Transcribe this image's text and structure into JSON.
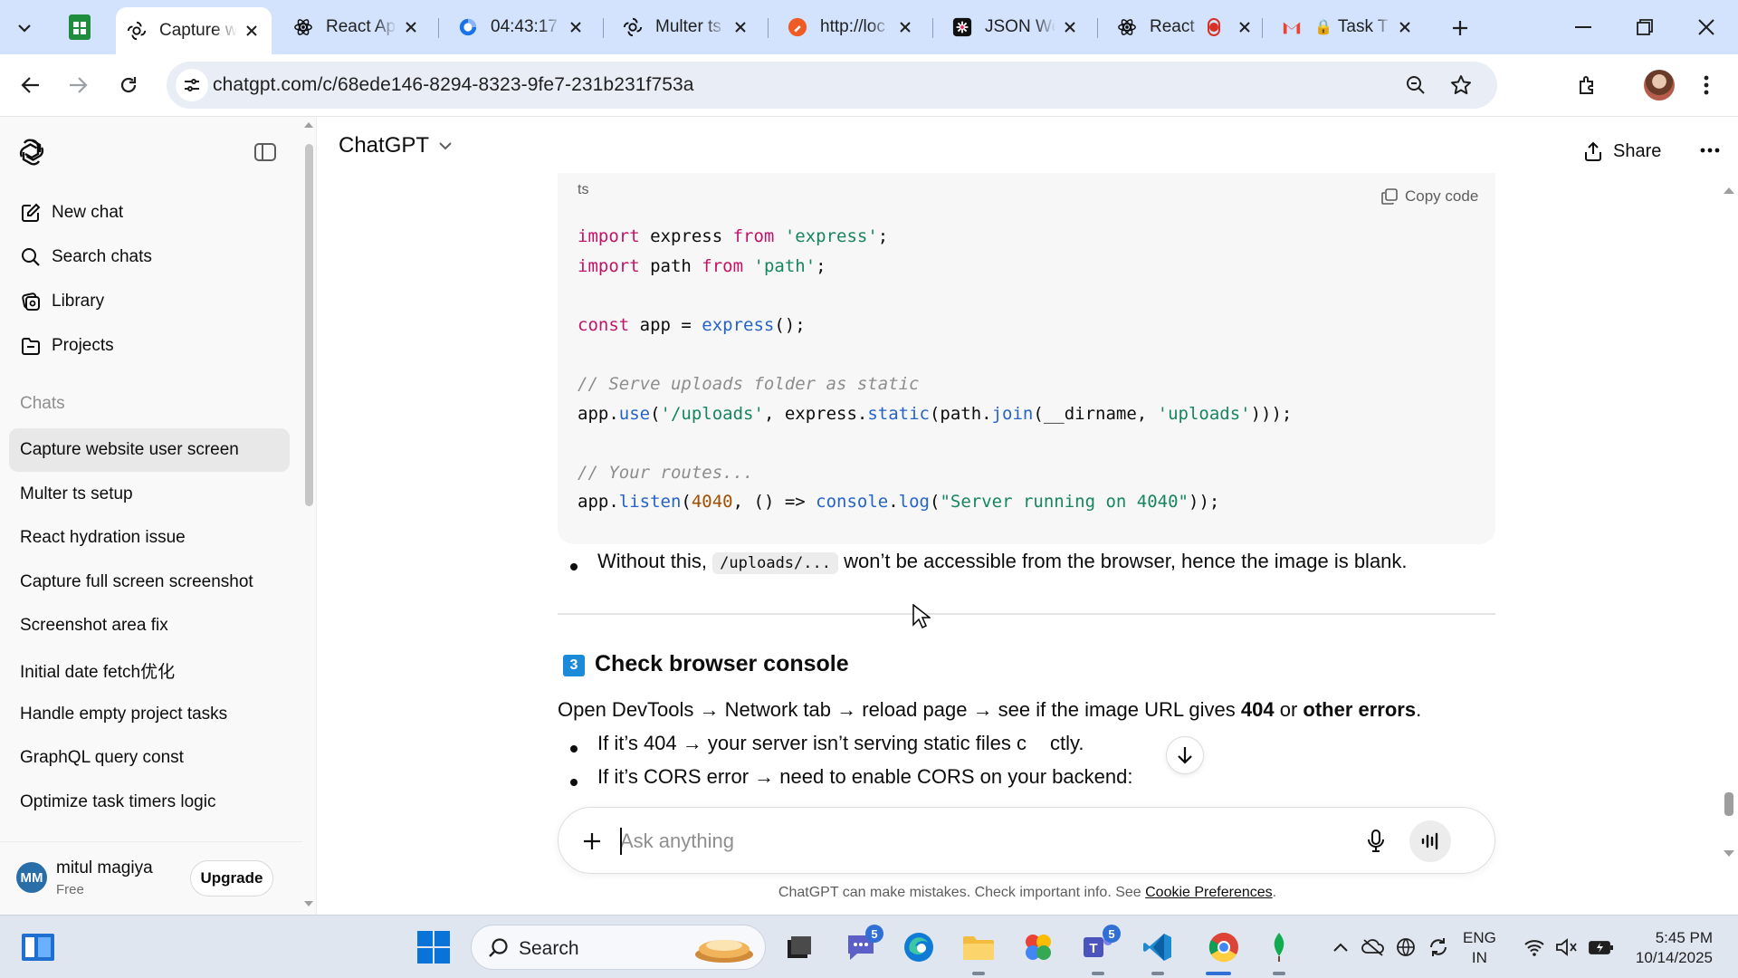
{
  "browser": {
    "tabs": [
      {
        "title": "Capture w",
        "icon": "chatgpt-icon",
        "active": true
      },
      {
        "title": "React Ap",
        "icon": "react-icon"
      },
      {
        "title": "04:43:17 -",
        "icon": "screen-recorder-icon"
      },
      {
        "title": "Multer ts",
        "icon": "chatgpt-icon"
      },
      {
        "title": "http://loc",
        "icon": "postman-icon"
      },
      {
        "title": "JSON We",
        "icon": "json-web-icon"
      },
      {
        "title": "React",
        "icon": "react-icon",
        "recording": true
      },
      {
        "title": "Task T",
        "icon": "gmail-icon"
      }
    ],
    "url": "chatgpt.com/c/68ede146-8294-8323-9fe7-231b231f753a"
  },
  "sidebar": {
    "primary": [
      {
        "label": "New chat",
        "icon": "new-chat-icon"
      },
      {
        "label": "Search chats",
        "icon": "search-icon"
      },
      {
        "label": "Library",
        "icon": "library-icon"
      },
      {
        "label": "Projects",
        "icon": "projects-icon"
      }
    ],
    "chats_heading": "Chats",
    "chats": [
      "Capture website user screen",
      "Multer ts setup",
      "React hydration issue",
      "Capture full screen screenshot",
      "Screenshot area fix",
      "Initial date fetch优化",
      "Handle empty project tasks",
      "GraphQL query const",
      "Optimize task timers logic"
    ],
    "active_chat_index": 0,
    "user": {
      "initials": "MM",
      "name": "mitul magiya",
      "plan": "Free",
      "upgrade_label": "Upgrade"
    }
  },
  "topbar": {
    "model": "ChatGPT",
    "share_label": "Share"
  },
  "conversation": {
    "code": {
      "lang": "ts",
      "copy_label": "Copy code"
    },
    "bullet1": {
      "pre": "Without this, ",
      "code": "/uploads/...",
      "post": " won’t be accessible from the browser, hence the image is blank."
    },
    "section": {
      "badge": "3",
      "title": "Check browser console"
    },
    "para": {
      "a": "Open DevTools → Network tab → reload page → see if the image URL gives ",
      "b": "404",
      "c": " or ",
      "d": "other errors",
      "e": "."
    },
    "bullet2": "If it’s 404 → your server isn’t serving static files c",
    "bullet2_tail": "ctly.",
    "bullet3": "If it’s CORS error → need to enable CORS on your backend:"
  },
  "composer": {
    "placeholder": "Ask anything",
    "disclaimer": "ChatGPT can make mistakes. Check important info. See ",
    "disclaimer_link": "Cookie Preferences",
    "disclaimer_end": "."
  },
  "taskbar": {
    "search_label": "Search",
    "teams_badge": "5",
    "taskview_badge": "5",
    "lang_top": "ENG",
    "lang_bottom": "IN",
    "time": "5:45 PM",
    "date": "10/14/2025"
  }
}
